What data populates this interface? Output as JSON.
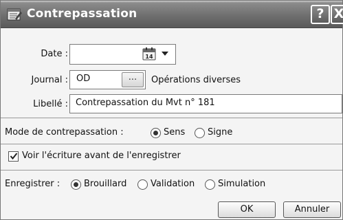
{
  "window": {
    "title": "Contrepassation",
    "help_label": "?",
    "close_label": "X"
  },
  "date": {
    "label": "Date :",
    "value": "",
    "calendar_day": "14"
  },
  "journal": {
    "label": "Journal :",
    "code": "OD",
    "browse_label": "...",
    "name": "Opérations diverses"
  },
  "libelle": {
    "label": "Libellé :",
    "value": "Contrepassation du Mvt n° 181"
  },
  "mode": {
    "label": "Mode de contrepassation :",
    "options": [
      {
        "label": "Sens",
        "selected": true
      },
      {
        "label": "Signe",
        "selected": false
      }
    ]
  },
  "preview": {
    "label": "Voir l'écriture avant de l'enregistrer",
    "checked": true
  },
  "enregistrer": {
    "label": "Enregistrer :",
    "options": [
      {
        "label": "Brouillard",
        "selected": true
      },
      {
        "label": "Validation",
        "selected": false
      },
      {
        "label": "Simulation",
        "selected": false
      }
    ]
  },
  "buttons": {
    "ok_label": "OK",
    "cancel_label": "Annuler"
  }
}
